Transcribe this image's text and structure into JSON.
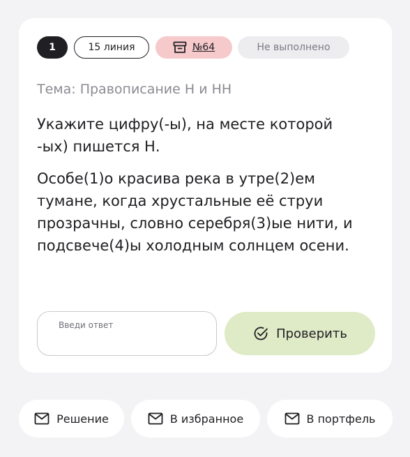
{
  "chips": {
    "number": "1",
    "line": "15 линия",
    "task": "№64",
    "status": "Не выполнено"
  },
  "topic": "Тема: Правописание Н и НН",
  "question": "Укажите цифру(-ы), на месте которой -ых) пишется Н.",
  "sentence": "Особе(1)о красива река в утре(2)ем тумане, когда хрустальные её струи прозрачны, словно серебря(3)ые нити, и подсвече(4)ы холодным солнцем осени.",
  "answer": {
    "placeholder": "Введи ответ",
    "value": ""
  },
  "check_button": "Проверить",
  "actions": {
    "solution": "Решение",
    "favorite": "В избранное",
    "portfolio": "В портфель"
  },
  "colors": {
    "background": "#f3f3f5",
    "chip_dark": "#1f1f24",
    "chip_task": "#f6c9cb",
    "chip_status": "#ededf0",
    "check_button": "#dfeac6"
  },
  "icons": {
    "task": "archive-box-icon",
    "check": "check-circle-icon",
    "actions": "envelope-icon"
  }
}
